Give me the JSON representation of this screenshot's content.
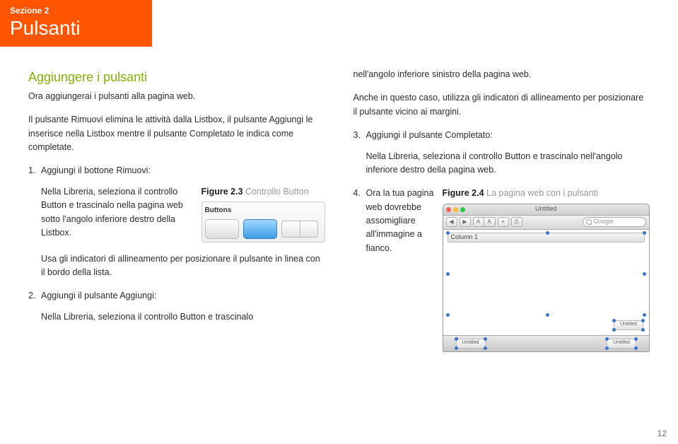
{
  "header": {
    "section": "Sezione 2",
    "title": "Pulsanti"
  },
  "left": {
    "subhead": "Aggiungere i pulsanti",
    "lead": "Ora aggiungerai i pulsanti alla pagina web.",
    "intro": "Il pulsante Rimuovi elimina le attività dalla Listbox, il pulsante Aggiungi le inserisce nella Listbox mentre il pulsante Completato le indica come completate.",
    "step1_num": "1.",
    "step1": "Aggiungi il bottone Rimuovi:",
    "step1_body": "Nella Libreria, seleziona il controllo Button e trascinalo nella pagina web sotto l'angolo inferiore destro della Listbox.",
    "fig23_bold": "Figure 2.3",
    "fig23_grey": " Controllo Button",
    "buttons_label": "Buttons",
    "step1_after": "Usa gli indicatori di allineamento per posizionare il pulsante in linea con il bordo della lista.",
    "step2_num": "2.",
    "step2": "Aggiungi il pulsante Aggiungi:",
    "step2_body": "Nella Libreria, seleziona il controllo Button e trascinalo"
  },
  "right": {
    "cont1": "nell'angolo inferiore sinistro della pagina web.",
    "cont2": "Anche in questo caso, utilizza gli indicatori di allineamento per posizionare il pulsante vicino ai margini.",
    "step3_num": "3.",
    "step3": "Aggiungi il pulsante Completato:",
    "step3_body": "Nella Libreria, seleziona il controllo Button e trascinalo nell'angolo inferiore destro della pagina web.",
    "step4_num": "4.",
    "step4": "Ora la tua pagina web dovrebbe assomigliare all'immagine a fianco.",
    "fig24_bold": "Figure 2.4",
    "fig24_grey": " La pagina web con i pulsanti",
    "window_title": "Untitled",
    "search_ph": "Google",
    "colhdr": "Column 1",
    "btn_label": "Untitled"
  },
  "pagenum": "12"
}
